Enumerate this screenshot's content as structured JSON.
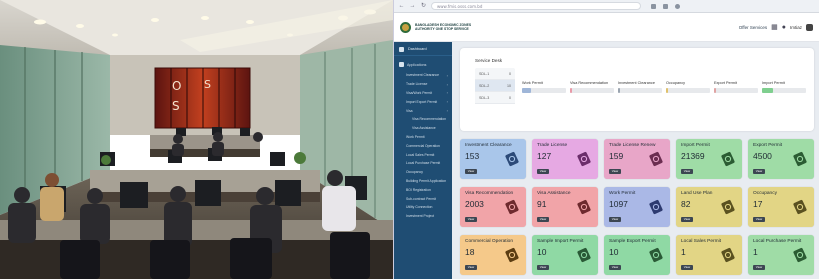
{
  "browser": {
    "url": "www.fmis.osss.com.bd",
    "nav_icons": [
      "back-icon",
      "forward-icon",
      "reload-icon"
    ]
  },
  "header": {
    "org_name": "BANGLADESH ECONOMIC ZONES AUTHORITY ONE STOP SERVICE",
    "offer_services": "Offer Services",
    "user_name": "Imtiaz"
  },
  "sidebar": {
    "dashboard": "Dashboard",
    "section": "Applications",
    "items": [
      {
        "label": "Investment Clearance",
        "sub": false,
        "chevron": true
      },
      {
        "label": "Trade License",
        "sub": false,
        "chevron": true
      },
      {
        "label": "Visa/Work Permit",
        "sub": false,
        "chevron": true
      },
      {
        "label": "Import Export Permit",
        "sub": false,
        "chevron": true
      },
      {
        "label": "Visa",
        "sub": false,
        "chevron": true
      },
      {
        "label": "Visa Recommendation",
        "sub": true,
        "chevron": false
      },
      {
        "label": "Visa Assistance",
        "sub": true,
        "chevron": false
      },
      {
        "label": "Work Permit",
        "sub": false,
        "chevron": false
      },
      {
        "label": "Commercial Operation",
        "sub": false,
        "chevron": false
      },
      {
        "label": "Local Sales Permit",
        "sub": false,
        "chevron": false
      },
      {
        "label": "Local Purchase Permit",
        "sub": false,
        "chevron": false
      },
      {
        "label": "Occupancy",
        "sub": false,
        "chevron": false
      },
      {
        "label": "Building Permit Application",
        "sub": false,
        "chevron": false
      },
      {
        "label": "BOI Registration",
        "sub": false,
        "chevron": false
      },
      {
        "label": "Sub-contract Permit",
        "sub": false,
        "chevron": false
      },
      {
        "label": "Utility Connection",
        "sub": false,
        "chevron": false
      },
      {
        "label": "Investment Project",
        "sub": false,
        "chevron": false
      }
    ]
  },
  "service_desk": {
    "title": "Service Desk",
    "levels": [
      {
        "label": "SDL-1",
        "count": "0",
        "selected": false
      },
      {
        "label": "SDL-2",
        "count": "10",
        "selected": true
      },
      {
        "label": "SDL-3",
        "count": "0",
        "selected": false
      }
    ],
    "metrics": [
      {
        "label": "Work Permit",
        "fill": 0.2,
        "color": "#9fb6d8"
      },
      {
        "label": "Visa Recommendation",
        "fill": 0.05,
        "color": "#e99aa8"
      },
      {
        "label": "Investment Clearance",
        "fill": 0.05,
        "color": "#9aa4b0"
      },
      {
        "label": "Occupancy",
        "fill": 0.05,
        "color": "#e0c16a"
      },
      {
        "label": "Export Permit",
        "fill": 0.05,
        "color": "#e0a3a3"
      },
      {
        "label": "Import Permit",
        "fill": 0.25,
        "color": "#7fcf8f"
      }
    ]
  },
  "tiles": [
    {
      "label": "Investment Clearance",
      "value": "153",
      "color": "#a9c6ea",
      "icon_color": "#2c4a78",
      "btn": "View"
    },
    {
      "label": "Trade License",
      "value": "127",
      "color": "#e6a9e3",
      "icon_color": "#6b2d6b",
      "btn": "View"
    },
    {
      "label": "Trade License Renew",
      "value": "159",
      "color": "#e8a6c8",
      "icon_color": "#6b2d50",
      "btn": "View"
    },
    {
      "label": "Import Permit",
      "value": "21369",
      "color": "#9fdca6",
      "icon_color": "#2b5c33",
      "btn": "View"
    },
    {
      "label": "Export Permit",
      "value": "4500",
      "color": "#9fdca6",
      "icon_color": "#2b5c33",
      "btn": "View"
    },
    {
      "label": "Visa Recommendation",
      "value": "2003",
      "color": "#f1a4a8",
      "icon_color": "#6e2a2e",
      "btn": "View"
    },
    {
      "label": "Visa Assistance",
      "value": "91",
      "color": "#f1a4a8",
      "icon_color": "#6e2a2e",
      "btn": "View"
    },
    {
      "label": "Work Permit",
      "value": "1097",
      "color": "#aab8e6",
      "icon_color": "#2d3a70",
      "btn": "View"
    },
    {
      "label": "Land Use Plan",
      "value": "82",
      "color": "#e2d585",
      "icon_color": "#5a5120",
      "btn": "View"
    },
    {
      "label": "Occupancy",
      "value": "17",
      "color": "#e2d585",
      "icon_color": "#5a5120",
      "btn": "View"
    },
    {
      "label": "Commercial Operation",
      "value": "18",
      "color": "#f5c98a",
      "icon_color": "#5c3d12",
      "btn": "View"
    },
    {
      "label": "Sample Import Permit",
      "value": "10",
      "color": "#8fd9a4",
      "icon_color": "#2a5a36",
      "btn": "View"
    },
    {
      "label": "Sample Export Permit",
      "value": "10",
      "color": "#8fd9a4",
      "icon_color": "#2a5a36",
      "btn": "View"
    },
    {
      "label": "Local Sales Permit",
      "value": "1",
      "color": "#e2d585",
      "icon_color": "#5a5120",
      "btn": "View"
    },
    {
      "label": "Local Purchase Permit",
      "value": "1",
      "color": "#9fdca6",
      "icon_color": "#2b5c33",
      "btn": "View"
    }
  ]
}
